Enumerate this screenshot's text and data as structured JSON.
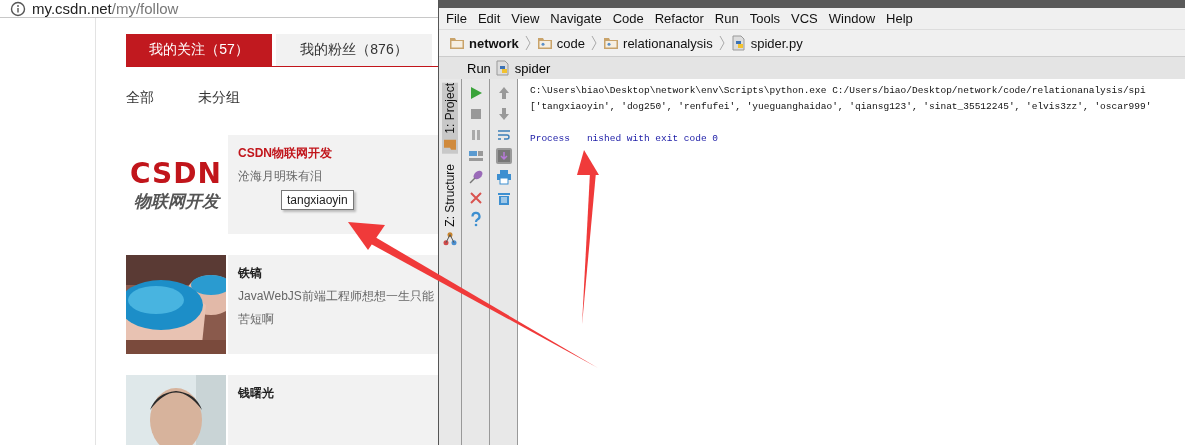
{
  "browser": {
    "url_host": "my.csdn.net",
    "url_path": "/my/follow"
  },
  "tabs": [
    {
      "label": "我的关注（57）",
      "selected": true
    },
    {
      "label": "我的粉丝（876）",
      "selected": false
    }
  ],
  "filters": [
    {
      "label": "全部"
    },
    {
      "label": "未分组"
    }
  ],
  "follows": [
    {
      "kind": "logo",
      "logo_mark": "CSDN",
      "logo_caption": "物联网开发",
      "name": "CSDN物联网开发",
      "highlighted": true,
      "lines": [
        "沧海月明珠有泪"
      ]
    },
    {
      "kind": "picture",
      "name": "铁镐",
      "highlighted": false,
      "lines": [
        "JavaWebJS前端工程师想想一生只能",
        "苦短啊"
      ]
    },
    {
      "kind": "figure",
      "name": "钱曙光",
      "highlighted": false
    }
  ],
  "tooltip": "tangxiaoyin",
  "ide": {
    "menu": [
      "File",
      "Edit",
      "View",
      "Navigate",
      "Code",
      "Refactor",
      "Run",
      "Tools",
      "VCS",
      "Window",
      "Help"
    ],
    "breadcrumbs": [
      {
        "label": "network",
        "kind": "folder"
      },
      {
        "label": "code",
        "kind": "package"
      },
      {
        "label": "relationanalysis",
        "kind": "package"
      },
      {
        "label": "spider.py",
        "kind": "python"
      }
    ],
    "run_label": "Run",
    "run_config": "spider",
    "side_tabs": [
      {
        "label": "1: Project",
        "kind": "project"
      },
      {
        "label": "Z: Structure",
        "kind": "structure"
      }
    ],
    "console": [
      {
        "kind": "command",
        "text": "C:\\Users\\biao\\Desktop\\network\\env\\Scripts\\python.exe C:/Users/biao/Desktop/network/code/relationanalysis/spi"
      },
      {
        "kind": "output",
        "text": "['tangxiaoyin', 'dog250', 'renfufei', 'yueguanghaidao', 'qiansg123', 'sinat_35512245', 'elvis3zz', 'oscar999'"
      },
      {
        "kind": "blank"
      },
      {
        "kind": "status",
        "parts": [
          "Process",
          "nished with exit code 0"
        ]
      }
    ]
  }
}
